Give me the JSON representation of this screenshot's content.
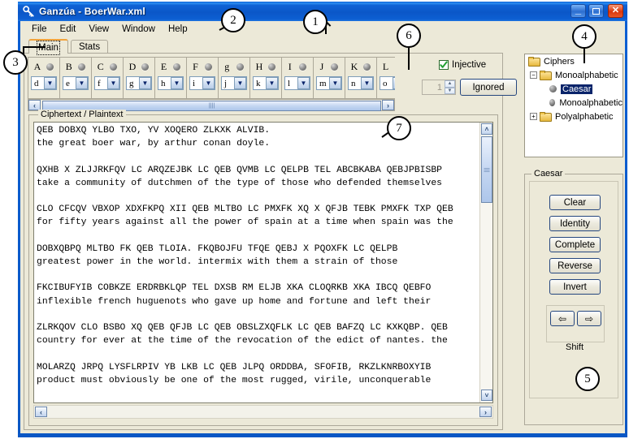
{
  "window": {
    "title": "Ganzúa - BoerWar.xml",
    "icon": "app-icon",
    "minimize_label": "–",
    "maximize_label": "□",
    "close_label": "✕"
  },
  "menu": {
    "items": [
      "File",
      "Edit",
      "View",
      "Window",
      "Help"
    ]
  },
  "tabs": [
    {
      "label": "Main",
      "active": true
    },
    {
      "label": "Stats",
      "active": false
    }
  ],
  "alphabet": {
    "columns": [
      {
        "letter": "A",
        "value": "d"
      },
      {
        "letter": "B",
        "value": "e"
      },
      {
        "letter": "C",
        "value": "f"
      },
      {
        "letter": "D",
        "value": "g"
      },
      {
        "letter": "E",
        "value": "h"
      },
      {
        "letter": "F",
        "value": "i"
      },
      {
        "letter": "g",
        "value": "j"
      },
      {
        "letter": "H",
        "value": "k"
      },
      {
        "letter": "I",
        "value": "l"
      },
      {
        "letter": "J",
        "value": "m"
      },
      {
        "letter": "K",
        "value": "n"
      },
      {
        "letter": "L",
        "value": "o"
      }
    ],
    "scroll_left_icon": "chevron-left-icon",
    "scroll_right_icon": "chevron-right-icon"
  },
  "options": {
    "injective_label": "Injective",
    "injective_checked": true,
    "spinner_value": "1",
    "spinner_enabled": false,
    "ignored_label": "Ignored"
  },
  "cipher_panel": {
    "legend": "Ciphertext / Plaintext",
    "text": "QEB DOBXQ YLBO TXO, YV XOQERO ZLKXK ALVIB.\nthe great boer war, by arthur conan doyle.\n\nQXHB X ZLJJRKFQV LC ARQZEJBK LC QEB QVMB LC QELPB TEL ABCBKABA QEBJPBISBP\ntake a community of dutchmen of the type of those who defended themselves\n\nCLO CFCQV VBXOP XDXFKPQ XII QEB MLTBO LC PMXFK XQ X QFJB TEBK PMXFK TXP QEB\nfor fifty years against all the power of spain at a time when spain was the\n\nDOBXQBPQ MLTBO FK QEB TLOIA. FKQBOJFU TFQE QEBJ X PQOXFK LC QELPB\ngreatest power in the world. intermix with them a strain of those\n\nFKCIBUFYIB COBKZE ERDRBKLQP TEL DXSB RM ELJB XKA CLOQRKB XKA IBCQ QEBFO\ninflexible french huguenots who gave up home and fortune and left their\n\nZLRKQOV CLO BSBO XQ QEB QFJB LC QEB OBSLZXQFLK LC QEB BAFZQ LC KXKQBP. QEB\ncountry for ever at the time of the revocation of the edict of nantes. the\n\nMOLARZQ JRPQ LYSFLRPIV YB LKB LC QEB JLPQ ORDDBA, SFOFIB, RKZLKNRBOXYIB\nproduct must obviously be one of the most rugged, virile, unconquerable",
    "vscroll_up_icon": "chevron-up-icon",
    "vscroll_down_icon": "chevron-down-icon",
    "hscroll_left_icon": "chevron-left-icon",
    "hscroll_right_icon": "chevron-right-icon"
  },
  "tree": {
    "root": "Ciphers",
    "nodes": [
      {
        "label": "Monoalphabetic",
        "expander": "−",
        "type": "folder",
        "indent": 1
      },
      {
        "label": "Caesar",
        "type": "leaf",
        "indent": 2,
        "selected": true
      },
      {
        "label": "Monoalphabetic",
        "type": "leaf",
        "indent": 2,
        "selected": false
      },
      {
        "label": "Polyalphabetic",
        "expander": "+",
        "type": "folder",
        "indent": 1
      }
    ]
  },
  "caesar_panel": {
    "legend": "Caesar",
    "buttons": [
      "Clear",
      "Identity",
      "Complete",
      "Reverse",
      "Invert"
    ],
    "shift": {
      "label": "Shift",
      "left_icon": "arrow-left-icon",
      "right_icon": "arrow-right-icon",
      "left_glyph": "⇦",
      "right_glyph": "⇨"
    }
  },
  "callouts": [
    {
      "n": "1"
    },
    {
      "n": "2"
    },
    {
      "n": "3"
    },
    {
      "n": "4"
    },
    {
      "n": "5"
    },
    {
      "n": "6"
    },
    {
      "n": "7"
    }
  ]
}
